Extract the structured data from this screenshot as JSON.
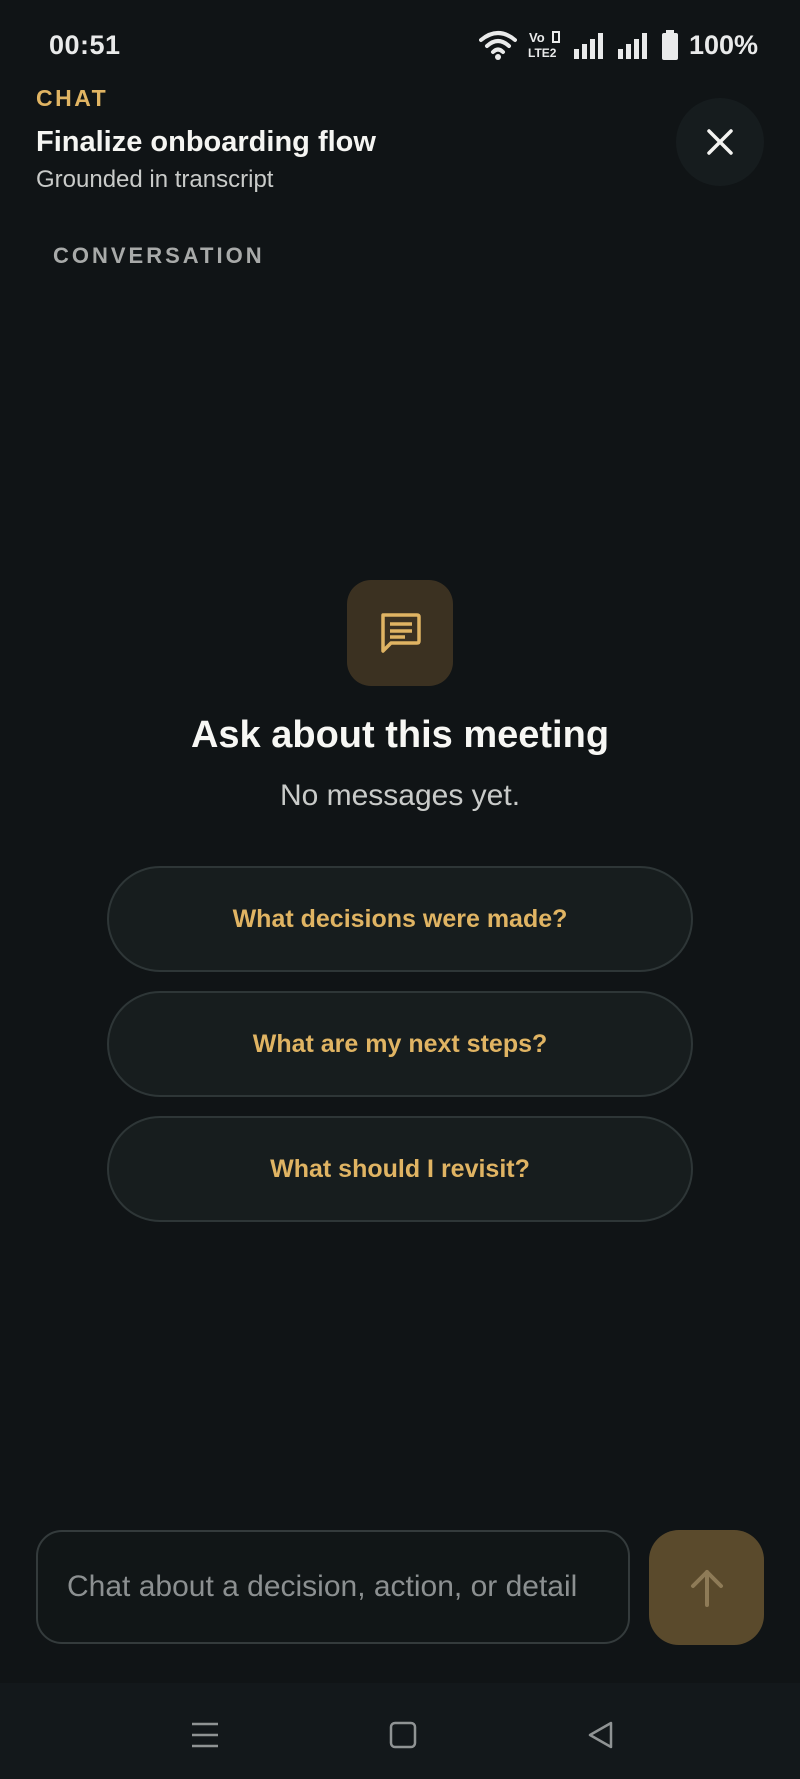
{
  "status_bar": {
    "time": "00:51",
    "battery_percent": "100%",
    "icons": [
      "wifi-icon",
      "volte-icon",
      "signal-icon",
      "signal-icon",
      "battery-icon"
    ],
    "volte_line1": "Vo",
    "volte_line2": "LTE2"
  },
  "header": {
    "eyebrow": "CHAT",
    "title": "Finalize onboarding flow",
    "subtitle": "Grounded in transcript",
    "close_icon": "close-icon"
  },
  "section_label": "CONVERSATION",
  "empty_state": {
    "icon": "chat-bubble-icon",
    "title": "Ask about this meeting",
    "subtitle": "No messages yet."
  },
  "suggestions": [
    "What decisions were made?",
    "What are my next steps?",
    "What should I revisit?"
  ],
  "composer": {
    "placeholder": "Chat about a decision, action, or detail",
    "value": "",
    "send_icon": "arrow-up-icon"
  },
  "nav": {
    "icons": [
      "menu-icon",
      "home-square-icon",
      "back-triangle-icon"
    ]
  },
  "colors": {
    "background": "#101416",
    "accent": "#e0b463",
    "send_button": "#5a4a2c"
  }
}
